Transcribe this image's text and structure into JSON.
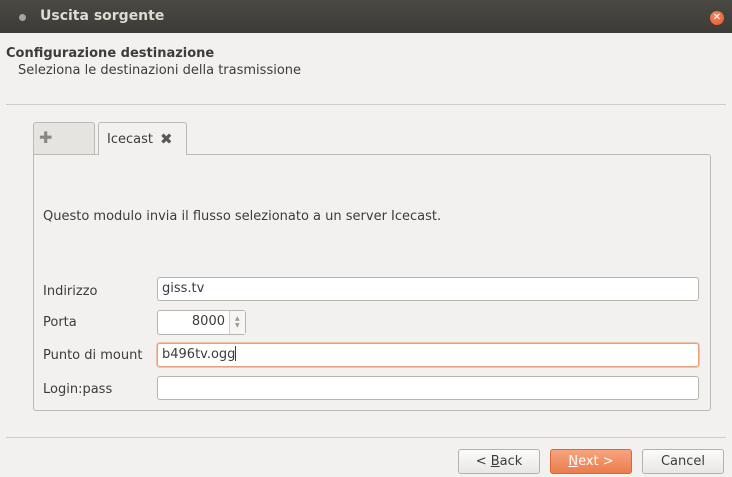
{
  "window": {
    "title": "Uscita sorgente"
  },
  "header": {
    "title": "Configurazione destinazione",
    "subtitle": "Seleziona le destinazioni della trasmissione"
  },
  "tabs": [
    {
      "label": "",
      "icon": "plus-icon"
    },
    {
      "label": "Icecast",
      "icon": "close-icon"
    }
  ],
  "panel": {
    "description": "Questo modulo invia il flusso selezionato a un server Icecast.",
    "fields": {
      "address": {
        "label": "Indirizzo",
        "value": "giss.tv"
      },
      "port": {
        "label": "Porta",
        "value": "8000"
      },
      "mount": {
        "label": "Punto di mount",
        "value": "b496tv.ogg"
      },
      "login": {
        "label": "Login:pass",
        "value": ""
      }
    }
  },
  "buttons": {
    "back_prefix": "< ",
    "back_accel": "B",
    "back_rest": "ack",
    "next_accel": "N",
    "next_rest": "ext >",
    "cancel": "Cancel"
  },
  "colors": {
    "accent": "#ec7c4c",
    "titlebar": "#3c3b37"
  }
}
